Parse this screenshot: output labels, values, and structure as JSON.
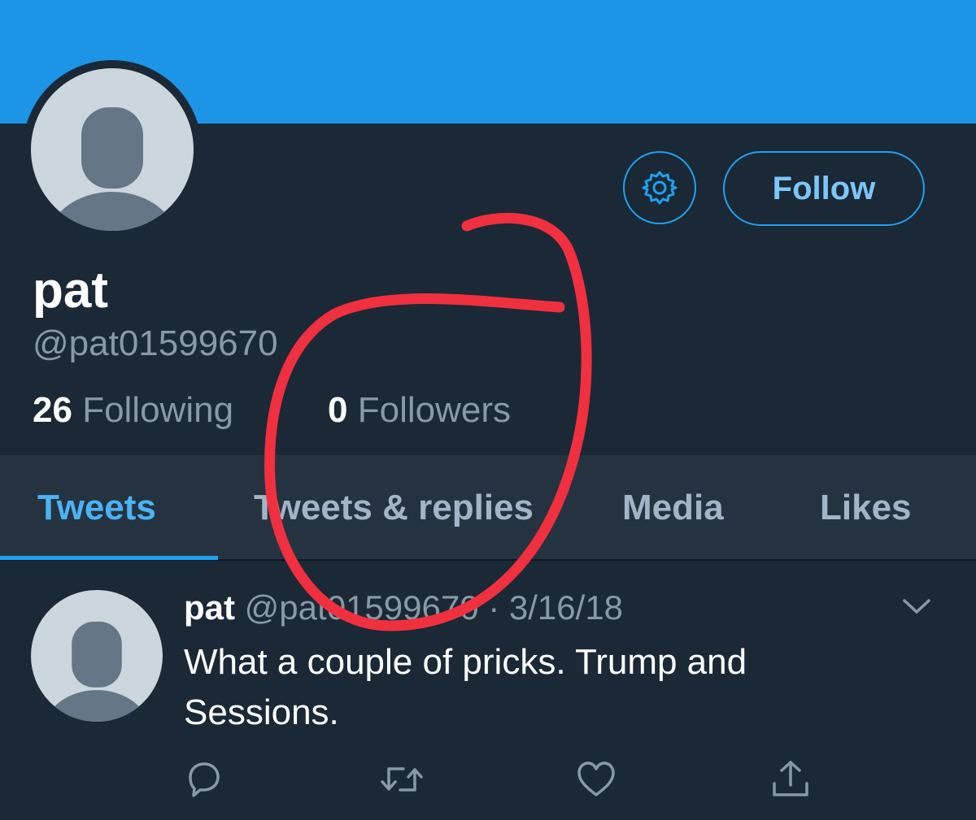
{
  "profile": {
    "name": "pat",
    "handle": "@pat01599670",
    "following_count": "26",
    "following_label": "Following",
    "followers_count": "0",
    "followers_label": "Followers",
    "follow_button_label": "Follow"
  },
  "tabs": [
    {
      "label": "Tweets",
      "active": true
    },
    {
      "label": "Tweets & replies",
      "active": false
    },
    {
      "label": "Media",
      "active": false
    },
    {
      "label": "Likes",
      "active": false
    }
  ],
  "tweet": {
    "name": "pat",
    "handle": "@pat01599670",
    "separator": "·",
    "date": "3/16/18",
    "text": "What a couple of pricks. Trump and Sessions."
  },
  "tweet_actions": [
    "reply-icon",
    "retweet-icon",
    "like-icon",
    "share-icon"
  ],
  "colors": {
    "banner": "#1c95e6",
    "background": "#1b2836",
    "accent": "#1da1f2",
    "annotation": "#f0303f"
  }
}
